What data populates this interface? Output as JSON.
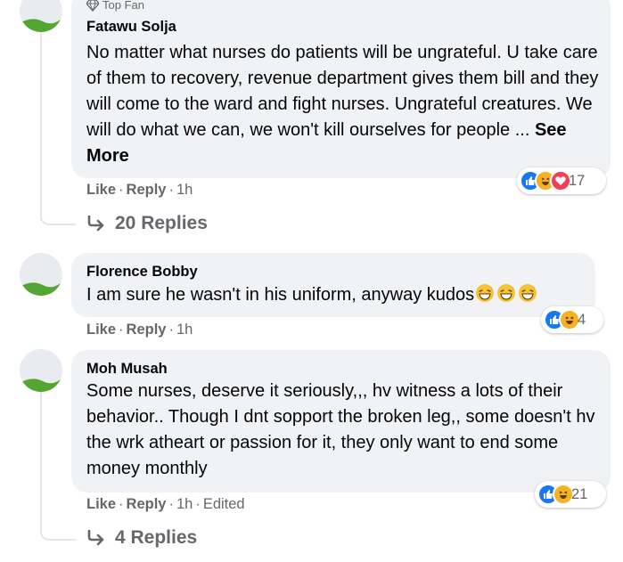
{
  "comments": [
    {
      "badge": "Top Fan",
      "author": "Fatawu Solja",
      "text": "No matter what nurses do patients will be ungrateful. U take care of them to recovery, revenue department gives them bill and they will come to the ward and fight nurses. Ungrateful creatures. We will do what we can, we won't kill ourselves for people ...",
      "see_more": "See More",
      "actions": {
        "like": "Like",
        "reply": "Reply",
        "time": "1h"
      },
      "reactions": {
        "icons": [
          "like-icon",
          "haha-icon",
          "love-icon"
        ],
        "count": "17"
      },
      "replies_label": "20 Replies"
    },
    {
      "author": "Florence Bobby",
      "text": "I am sure he wasn't in his uniform, anyway kudos",
      "emojis": [
        "grinning-sweat-emoji",
        "grinning-sweat-emoji",
        "grinning-sweat-emoji"
      ],
      "actions": {
        "like": "Like",
        "reply": "Reply",
        "time": "1h"
      },
      "reactions": {
        "icons": [
          "like-icon",
          "haha-icon"
        ],
        "count": "4"
      }
    },
    {
      "author": "Moh Musah",
      "text": "Some nurses, deserve it seriously,,, hv witness a lots of their behavior.. Though I dnt sopport the broken leg,, some doesn't hv the wrk atheart or passion for it, they only want to end some money monthly",
      "actions": {
        "like": "Like",
        "reply": "Reply",
        "time": "1h",
        "edited": "Edited"
      },
      "reactions": {
        "icons": [
          "like-icon",
          "haha-icon"
        ],
        "count": "21"
      },
      "replies_label": "4 Replies"
    }
  ],
  "colors": {
    "bubble": "#f0f2f5",
    "meta_text": "#65676b",
    "like_blue": "#1877f2",
    "love_red": "#f33e58",
    "haha_yellow": "#f7b125"
  }
}
